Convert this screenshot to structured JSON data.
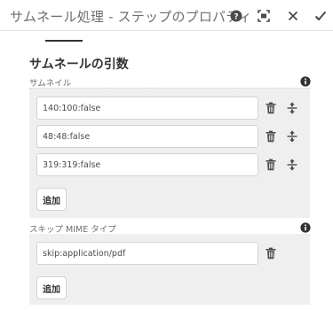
{
  "dialog": {
    "title": "サムネール処理 - ステップのプロパティ",
    "actions": {
      "help": "help-icon",
      "fullscreen": "fullscreen-icon",
      "close": "close-icon",
      "done": "checkmark-icon"
    }
  },
  "section": {
    "title": "サムネールの引数"
  },
  "thumbnails": {
    "label": "サムネイル",
    "items": [
      "140:100:false",
      "48:48:false",
      "319:319:false"
    ],
    "add_label": "追加"
  },
  "skip_mime": {
    "label": "スキップ MIME タイプ",
    "items": [
      "skip:application/pdf"
    ],
    "add_label": "追加"
  },
  "colors": {
    "accent": "#323232",
    "panel": "#efefef",
    "muted": "#6e6e6e"
  }
}
